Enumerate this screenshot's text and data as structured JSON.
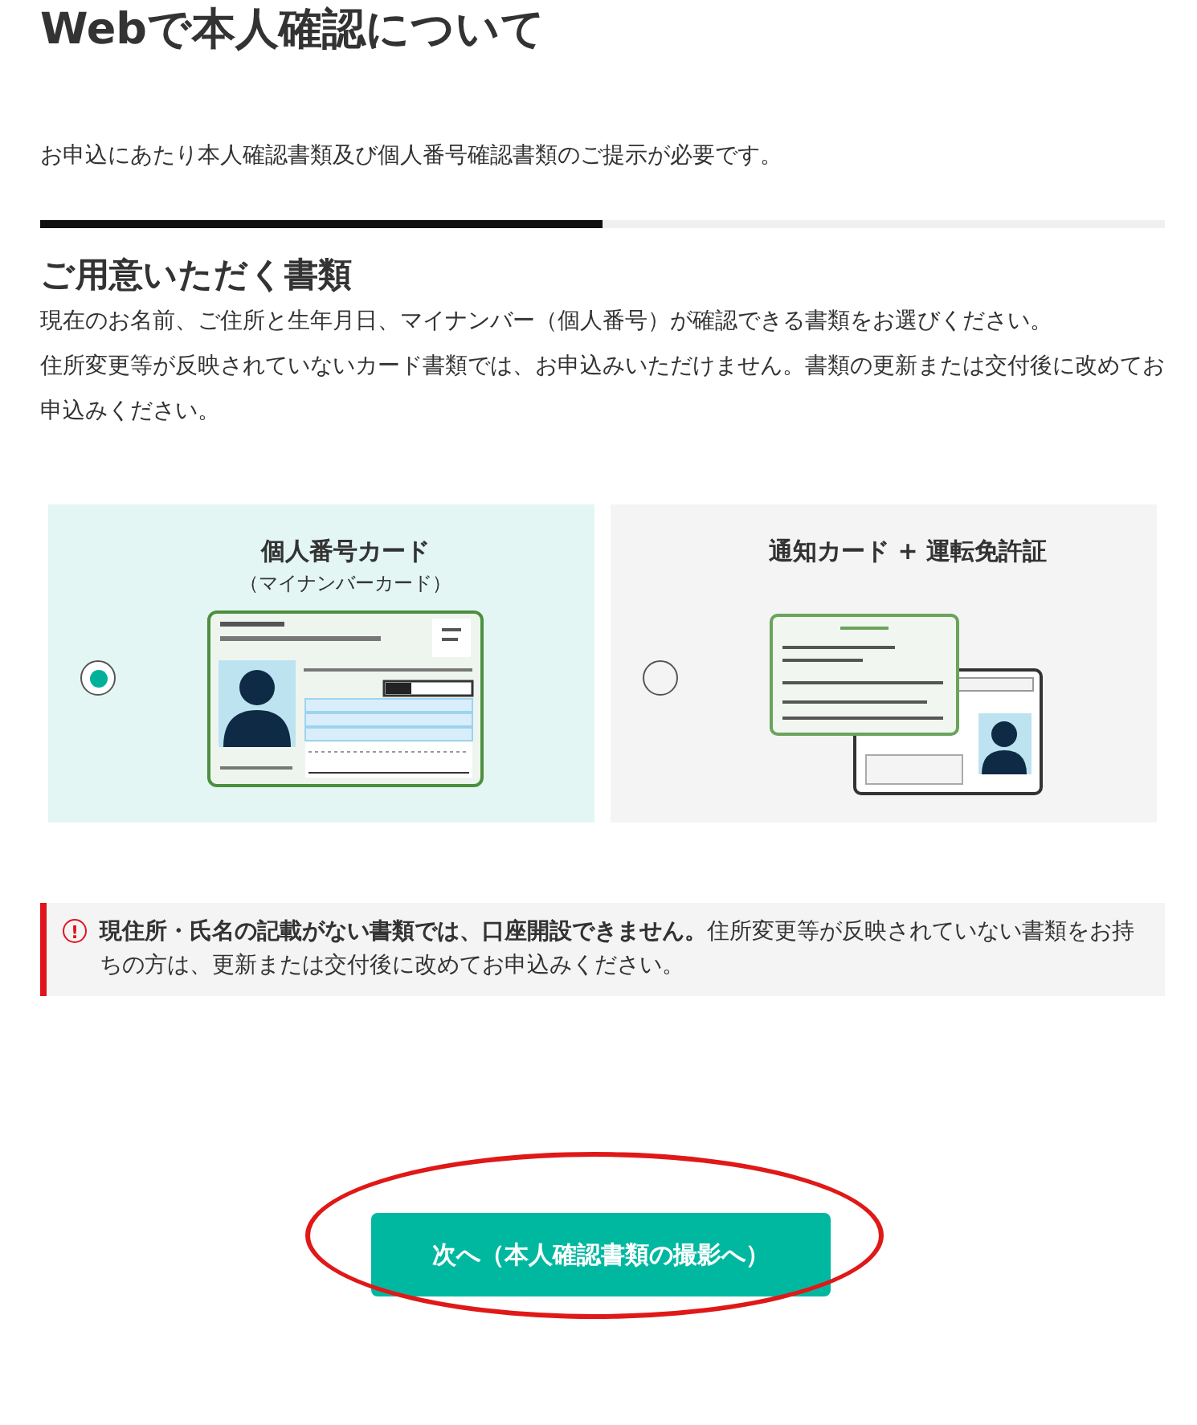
{
  "title": "Webで本人確認について",
  "intro": "お申込にあたり本人確認書類及び個人番号確認書類のご提示が必要です。",
  "progress": {
    "level": 0.5
  },
  "section_title": "ご用意いただく書類",
  "description": [
    "現在のお名前、ご住所と生年月日、マイナンバー（個人番号）が確認できる書類をお選びください。",
    "住所変更等が反映されていないカード書類では、お申込みいただけません。書類の更新または交付後に改めてお申込みください。"
  ],
  "options": [
    {
      "kind": "mynumber",
      "title": "個人番号カード",
      "subtitle": "（マイナンバーカード）",
      "selected": true
    },
    {
      "kind": "notice_license",
      "title": "通知カード + 運転免許証",
      "selected": false
    }
  ],
  "warning": {
    "icon": "!",
    "text": "**現住所・氏名の記載がない書類では、口座開設できません。**住所変更等が反映されていない書類をお持ちの方は、更新または交付後に改めてお申込みください。"
  },
  "next_button": "次へ（本人確認書類の撮影へ）"
}
